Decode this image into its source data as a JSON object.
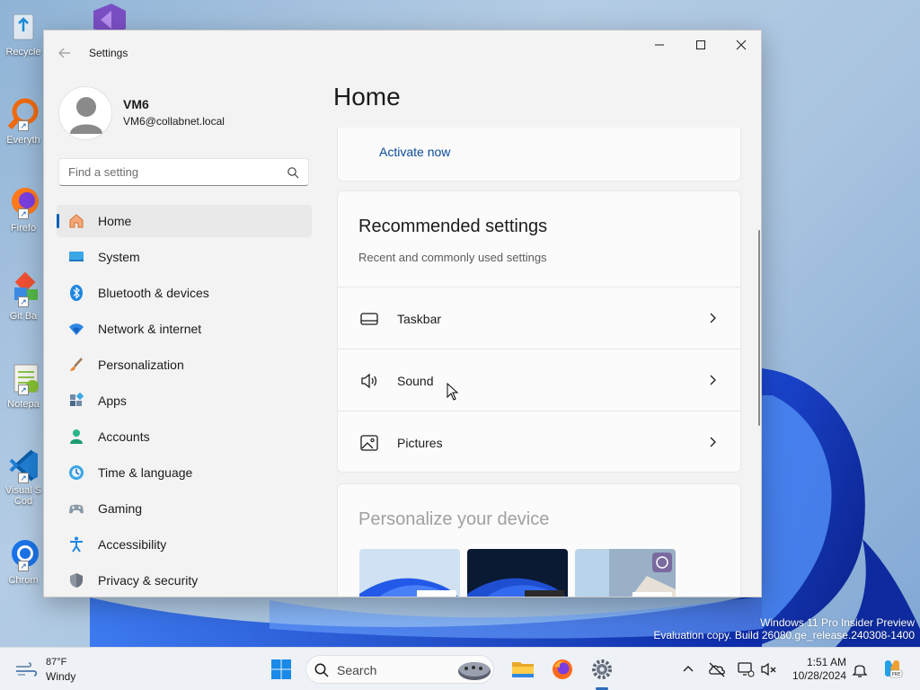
{
  "desktop": {
    "icons": [
      {
        "label": "Recycle",
        "icon": "recycle-bin-icon"
      },
      {
        "label": "Everyth",
        "icon": "everything-search-icon"
      },
      {
        "label": "Firefo",
        "icon": "firefox-icon"
      },
      {
        "label": "Git Ba",
        "icon": "git-bash-icon"
      },
      {
        "label": "Notepa",
        "icon": "notepad-plus-icon"
      },
      {
        "label": "Visual S",
        "label2": "Cod",
        "icon": "vscode-icon"
      },
      {
        "label": "Chrom",
        "icon": "chrome-icon"
      }
    ],
    "watermark": {
      "line1": "Windows 11 Pro Insider Preview",
      "line2": "Evaluation copy. Build 26080.ge_release.240308-1400"
    }
  },
  "window": {
    "title": "Settings",
    "controls": {
      "minimize": "minimize-icon",
      "maximize": "maximize-icon",
      "close": "close-icon"
    },
    "user": {
      "name": "VM6",
      "email": "VM6@collabnet.local"
    },
    "search": {
      "placeholder": "Find a setting",
      "value": ""
    },
    "nav": [
      {
        "label": "Home",
        "icon": "home-icon",
        "active": true
      },
      {
        "label": "System",
        "icon": "system-icon"
      },
      {
        "label": "Bluetooth & devices",
        "icon": "bluetooth-icon"
      },
      {
        "label": "Network & internet",
        "icon": "network-icon"
      },
      {
        "label": "Personalization",
        "icon": "brush-icon"
      },
      {
        "label": "Apps",
        "icon": "apps-icon"
      },
      {
        "label": "Accounts",
        "icon": "accounts-icon"
      },
      {
        "label": "Time & language",
        "icon": "time-language-icon"
      },
      {
        "label": "Gaming",
        "icon": "gaming-icon"
      },
      {
        "label": "Accessibility",
        "icon": "accessibility-icon"
      },
      {
        "label": "Privacy & security",
        "icon": "shield-icon"
      }
    ],
    "page_title": "Home",
    "activate": {
      "link": "Activate now"
    },
    "recommended": {
      "title": "Recommended settings",
      "subtitle": "Recent and commonly used settings",
      "items": [
        {
          "label": "Taskbar",
          "icon": "taskbar-icon"
        },
        {
          "label": "Sound",
          "icon": "sound-icon"
        },
        {
          "label": "Pictures",
          "icon": "pictures-icon"
        }
      ]
    },
    "personalize": {
      "title": "Personalize your device"
    }
  },
  "taskbar": {
    "weather": {
      "temp": "87°F",
      "condition": "Windy"
    },
    "search": {
      "label": "Search"
    },
    "clock": {
      "time": "1:51 AM",
      "date": "10/28/2024"
    }
  },
  "colors": {
    "accent": "#005fb8",
    "link": "#0a4b9c"
  }
}
